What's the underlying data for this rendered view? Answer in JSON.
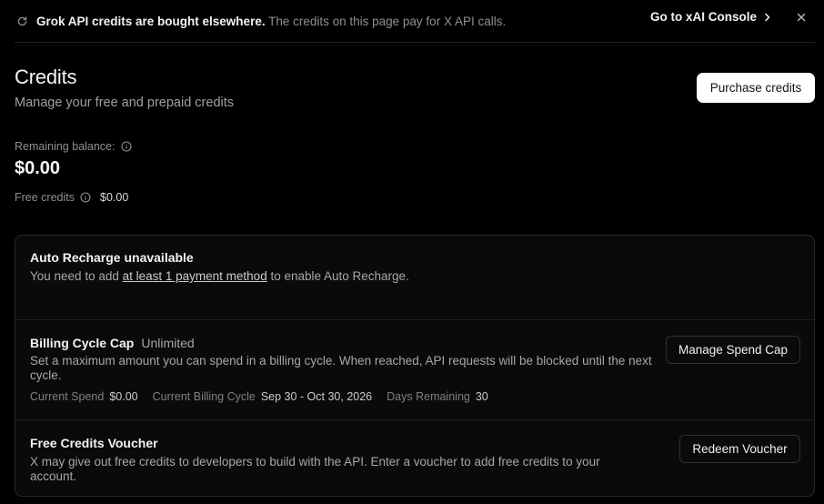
{
  "banner": {
    "strong_text": "Grok API credits are bought elsewhere.",
    "text": " The credits on this page pay for X API calls.",
    "link_label": "Go to xAI Console",
    "icon": "refresh-icon"
  },
  "header": {
    "title": "Credits",
    "subtitle": "Manage your free and prepaid credits",
    "purchase_label": "Purchase credits"
  },
  "balance": {
    "remaining_label": "Remaining balance:",
    "remaining_value": "$0.00",
    "free_label": "Free credits",
    "free_value": "$0.00"
  },
  "auto_recharge": {
    "title": "Auto Recharge unavailable",
    "desc_before": "You need to add ",
    "desc_link": "at least 1 payment method",
    "desc_after": " to enable Auto Recharge."
  },
  "billing_cap": {
    "title": "Billing Cycle Cap",
    "tag": "Unlimited",
    "desc": "Set a maximum amount you can spend in a billing cycle. When reached, API requests will be blocked until the next cycle.",
    "current_spend_label": "Current Spend",
    "current_spend_value": "$0.00",
    "cycle_label": "Current Billing Cycle",
    "cycle_value": "Sep 30 - Oct 30, 2026",
    "days_label": "Days Remaining",
    "days_value": "30",
    "button_label": "Manage Spend Cap"
  },
  "voucher": {
    "title": "Free Credits Voucher",
    "desc": "X may give out free credits to developers to build with the API. Enter a voucher to add free credits to your account.",
    "button_label": "Redeem Voucher"
  },
  "colors": {
    "background": "#000000",
    "card": "#0a0a0a",
    "border": "#26292d",
    "primary_button": "#ffffff"
  }
}
